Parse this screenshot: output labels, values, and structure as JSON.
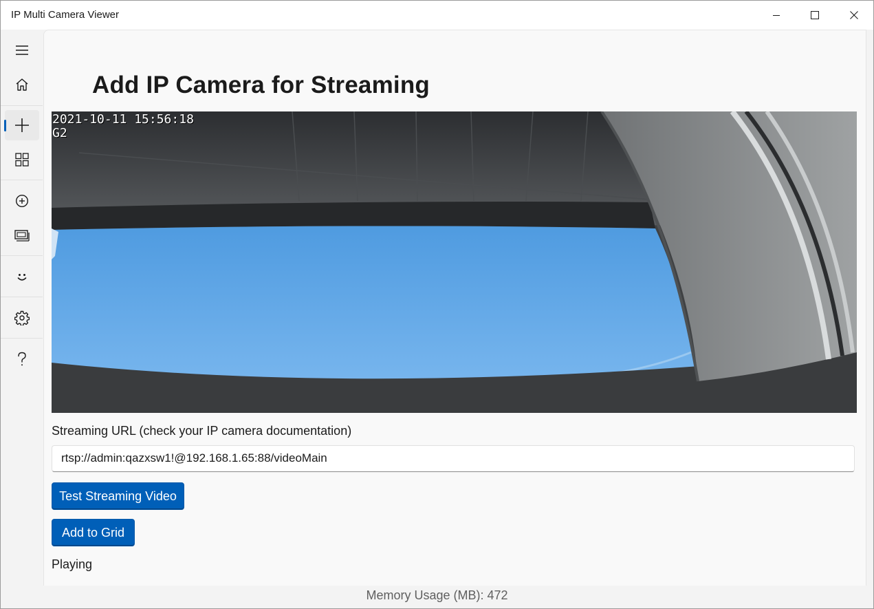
{
  "window": {
    "title": "IP Multi Camera Viewer"
  },
  "nav": {
    "items": [
      {
        "name": "menu-icon"
      },
      {
        "name": "home-icon"
      },
      {
        "name": "add-icon",
        "selected": true
      },
      {
        "name": "grid-icon"
      },
      {
        "name": "add-circle-icon"
      },
      {
        "name": "slideshow-icon"
      },
      {
        "name": "smiley-icon"
      },
      {
        "name": "settings-icon"
      },
      {
        "name": "help-icon"
      }
    ],
    "accent": "#005fb8"
  },
  "page": {
    "title": "Add IP Camera for Streaming",
    "video_overlay_timestamp": "2021-10-11 15:56:18",
    "video_overlay_camera": "G2",
    "url_label": "Streaming URL (check your IP camera documentation)",
    "url_value": "rtsp://admin:qazxsw1!@192.168.1.65:88/videoMain",
    "test_button": "Test Streaming Video",
    "add_button": "Add to Grid",
    "status": "Playing"
  },
  "footer": {
    "memory": "Memory Usage (MB): 472"
  }
}
